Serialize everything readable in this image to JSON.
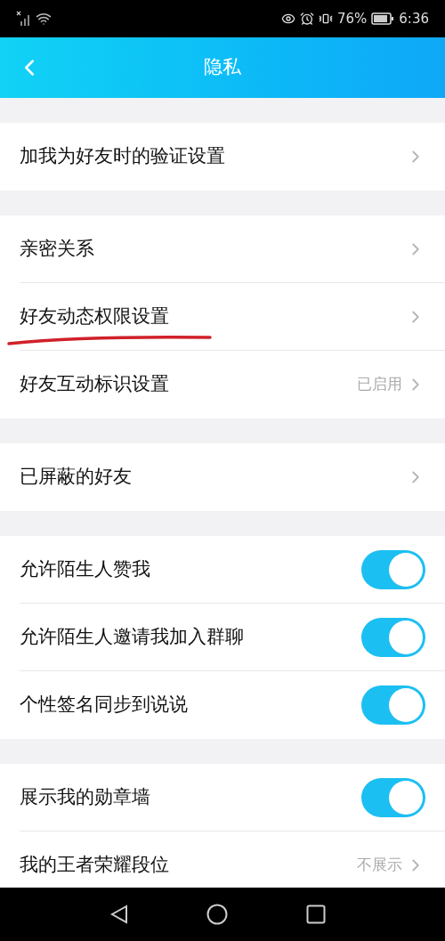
{
  "status_bar": {
    "battery": "76%",
    "time": "6:36"
  },
  "header": {
    "title": "隐私"
  },
  "groups": [
    {
      "rows": [
        {
          "kind": "link",
          "label": "加我为好友时的验证设置",
          "underlined": false
        }
      ]
    },
    {
      "rows": [
        {
          "kind": "link",
          "label": "亲密关系",
          "underlined": false
        },
        {
          "kind": "link",
          "label": "好友动态权限设置",
          "underlined": true
        },
        {
          "kind": "link",
          "label": "好友互动标识设置",
          "value": "已启用",
          "underlined": false
        }
      ]
    },
    {
      "rows": [
        {
          "kind": "link",
          "label": "已屏蔽的好友",
          "underlined": false
        }
      ]
    },
    {
      "rows": [
        {
          "kind": "toggle",
          "label": "允许陌生人赞我",
          "on": true
        },
        {
          "kind": "toggle",
          "label": "允许陌生人邀请我加入群聊",
          "on": true
        },
        {
          "kind": "toggle",
          "label": "个性签名同步到说说",
          "on": true
        }
      ]
    },
    {
      "rows": [
        {
          "kind": "toggle",
          "label": "展示我的勋章墙",
          "on": true
        },
        {
          "kind": "link",
          "label": "我的王者荣耀段位",
          "value": "不展示",
          "underlined": false
        }
      ]
    }
  ]
}
